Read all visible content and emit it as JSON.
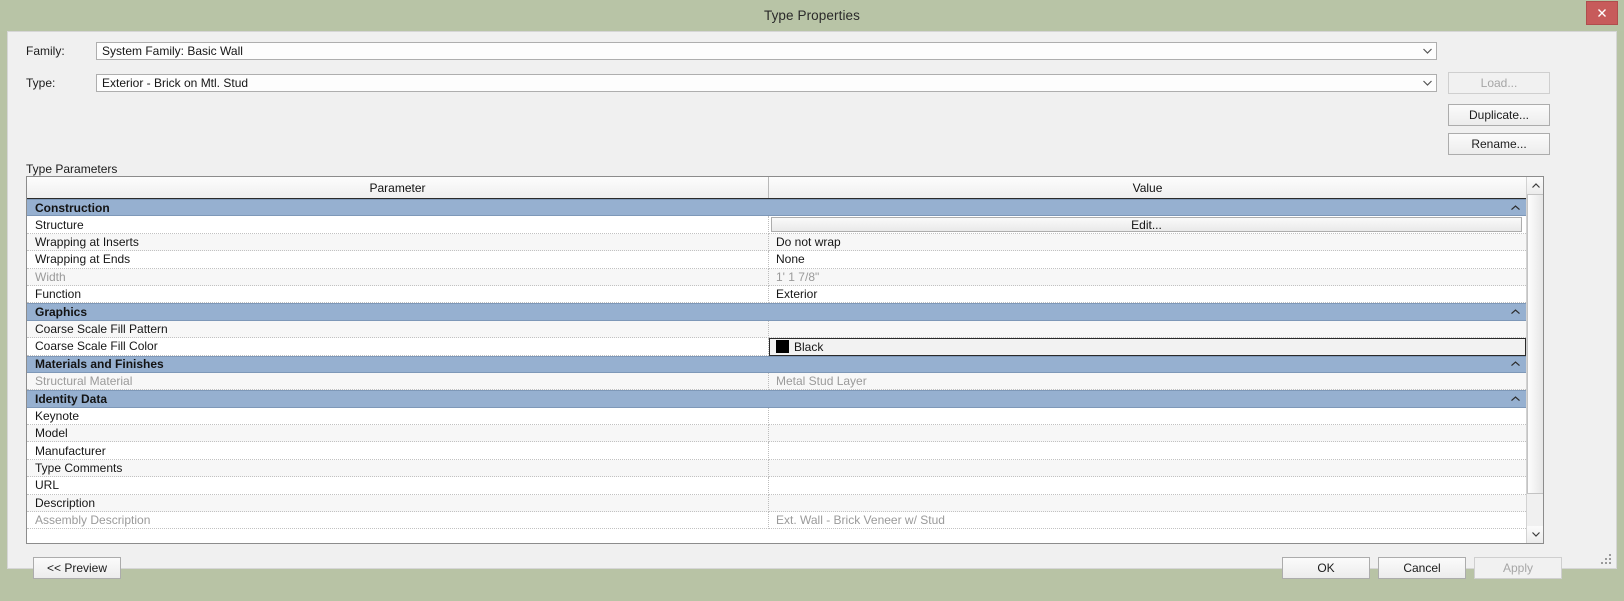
{
  "window": {
    "title": "Type Properties",
    "close_icon": "close-x-icon"
  },
  "form": {
    "family_label": "Family:",
    "family_value": "System Family: Basic Wall",
    "type_label": "Type:",
    "type_value": "Exterior - Brick on Mtl. Stud",
    "dropdown_icon": "chevron-down-icon"
  },
  "side_buttons": {
    "load": "Load...",
    "duplicate": "Duplicate...",
    "rename": "Rename..."
  },
  "grid": {
    "caption": "Type Parameters",
    "columns": [
      "Parameter",
      "Value"
    ],
    "collapse_icon": "chevron-up-icon",
    "sections": [
      {
        "name": "Construction",
        "rows": [
          {
            "parameter": "Structure",
            "value": "Edit...",
            "kind": "button",
            "readonly": false
          },
          {
            "parameter": "Wrapping at Inserts",
            "value": "Do not wrap",
            "kind": "text",
            "readonly": false
          },
          {
            "parameter": "Wrapping at Ends",
            "value": "None",
            "kind": "text",
            "readonly": false
          },
          {
            "parameter": "Width",
            "value": "1'  1 7/8\"",
            "kind": "text",
            "readonly": true
          },
          {
            "parameter": "Function",
            "value": "Exterior",
            "kind": "text",
            "readonly": false
          }
        ]
      },
      {
        "name": "Graphics",
        "rows": [
          {
            "parameter": "Coarse Scale Fill Pattern",
            "value": "",
            "kind": "text",
            "readonly": false
          },
          {
            "parameter": "Coarse Scale Fill Color",
            "value": "Black",
            "kind": "color",
            "readonly": false,
            "swatch": "#000000",
            "focused": true
          }
        ]
      },
      {
        "name": "Materials and Finishes",
        "rows": [
          {
            "parameter": "Structural Material",
            "value": "Metal Stud Layer",
            "kind": "text",
            "readonly": true
          }
        ]
      },
      {
        "name": "Identity Data",
        "rows": [
          {
            "parameter": "Keynote",
            "value": "",
            "kind": "text",
            "readonly": false
          },
          {
            "parameter": "Model",
            "value": "",
            "kind": "text",
            "readonly": false
          },
          {
            "parameter": "Manufacturer",
            "value": "",
            "kind": "text",
            "readonly": false
          },
          {
            "parameter": "Type Comments",
            "value": "",
            "kind": "text",
            "readonly": false
          },
          {
            "parameter": "URL",
            "value": "",
            "kind": "text",
            "readonly": false
          },
          {
            "parameter": "Description",
            "value": "",
            "kind": "text",
            "readonly": false
          },
          {
            "parameter": "Assembly Description",
            "value": "Ext. Wall - Brick Veneer w/ Stud",
            "kind": "text",
            "readonly": true
          }
        ]
      }
    ]
  },
  "footer": {
    "preview": "<< Preview",
    "ok": "OK",
    "cancel": "Cancel",
    "apply": "Apply"
  },
  "colors": {
    "titlebar": "#b8c4a6",
    "close": "#c75b5b",
    "section_header": "#96b0d0",
    "dialog_bg": "#f0f0f0"
  }
}
